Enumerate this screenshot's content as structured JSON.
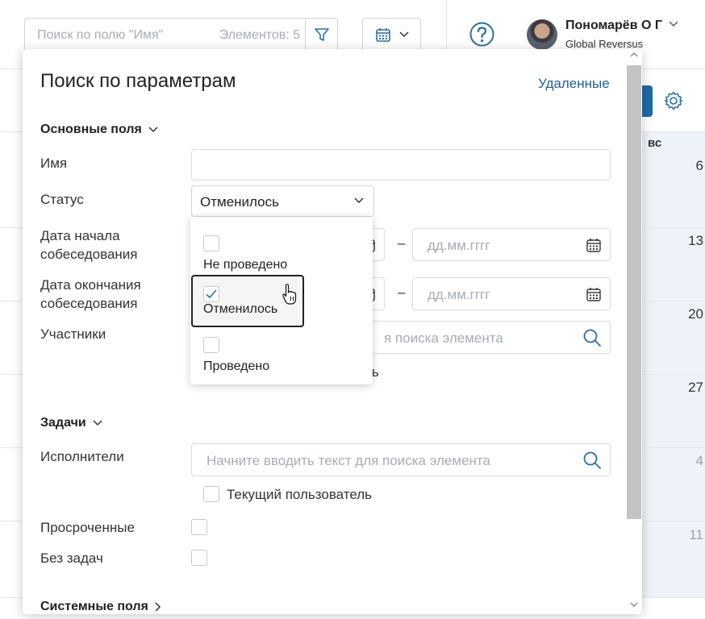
{
  "topbar": {
    "search_placeholder": "Поиск по полю \"Имя\"",
    "items_count": "Элементов: 5",
    "filter_icon": "filter-icon",
    "calendar_icon": "calendar-icon",
    "help_icon": "help-icon",
    "user_name": "Пономарёв О Г",
    "user_org": "Global Reversus"
  },
  "background": {
    "weekday": "вс",
    "days": [
      "6",
      "13",
      "20",
      "27",
      "4",
      "11"
    ]
  },
  "panel": {
    "title": "Поиск по параметрам",
    "deleted_link": "Удаленные",
    "main_section": "Основные поля",
    "labels": {
      "name": "Имя",
      "status": "Статус",
      "start_date": "Дата начала собеседования",
      "end_date": "Дата окончания собеседования",
      "participants": "Участники"
    },
    "status_value": "Отменилось",
    "date_placeholder": "дд.мм.гггг",
    "search_placeholder": "Начните вводить текст для поиска элемента",
    "participants_search_placeholder_visible": "я поиска элемента",
    "current_user_partial": "ль",
    "tasks_section": "Задачи",
    "executors_label": "Исполнители",
    "current_user": "Текущий пользователь",
    "overdue_label": "Просроченные",
    "no_tasks_label": "Без задач",
    "system_section": "Системные поля"
  },
  "status_dropdown": {
    "options": [
      {
        "label": "Не проведено",
        "checked": false
      },
      {
        "label": "Отменилось",
        "checked": true
      },
      {
        "label": "Проведено",
        "checked": false
      }
    ]
  },
  "colors": {
    "accent": "#1f6aa5",
    "link": "#1f5f8f",
    "icon_blue": "#2b6ea6"
  }
}
